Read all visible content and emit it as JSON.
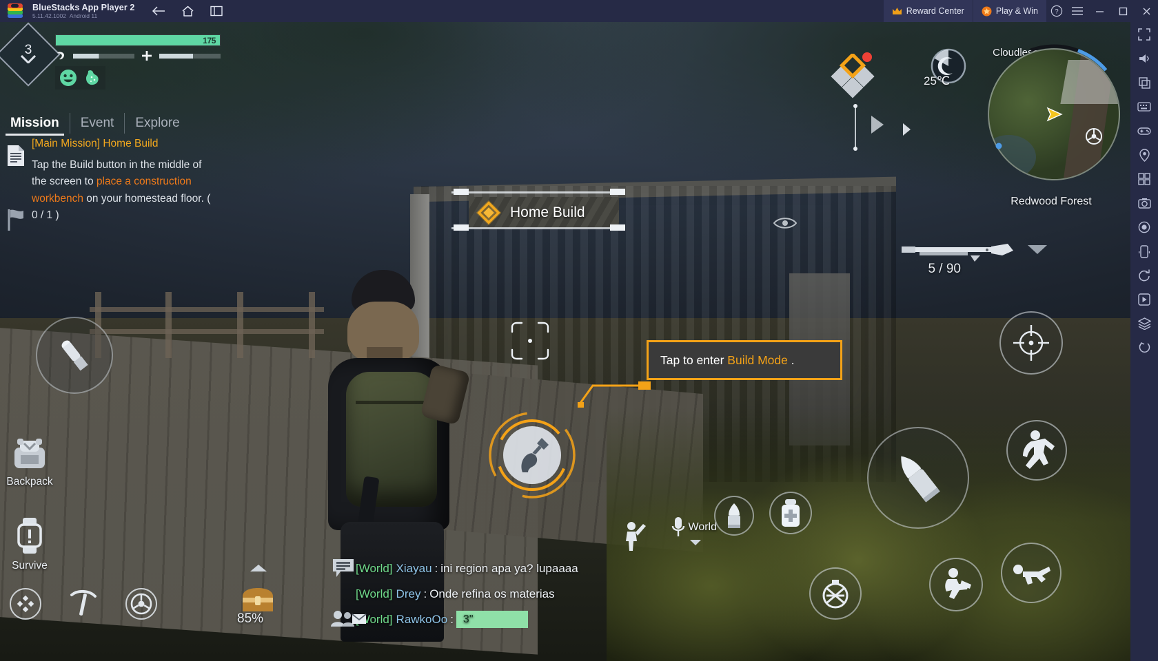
{
  "titlebar": {
    "app_name": "BlueStacks App Player 2",
    "version": "5.11.42.1002",
    "android": "Android 11",
    "nav": [
      {
        "name": "back-button",
        "label": "Back"
      },
      {
        "name": "home-button",
        "label": "Home"
      },
      {
        "name": "recents-button",
        "label": "Recents"
      }
    ],
    "reward_center": "Reward Center",
    "play_and_win": "Play & Win",
    "help": "?",
    "menu": "☰",
    "minimize": "—",
    "maximize": "□",
    "close": "✕"
  },
  "hud": {
    "level": "3",
    "health_text": "175",
    "health_pct": 100,
    "hunger_pct": 42,
    "thirst_pct": 55,
    "status_icons": [
      "mood-icon",
      "stomach-icon"
    ]
  },
  "mission": {
    "tabs": [
      {
        "label": "Mission",
        "active": true
      },
      {
        "label": "Event",
        "active": false
      },
      {
        "label": "Explore",
        "active": false
      }
    ],
    "title": "[Main Mission] Home Build",
    "desc_part1": "Tap the Build button in the middle of the screen to ",
    "desc_highlight": "place a construction workbench",
    "desc_part2": " on your homestead floor. ( 0 / 1 )"
  },
  "environment": {
    "weather": "Cloudless",
    "temperature": "25℃",
    "region": "Redwood Forest"
  },
  "weapon": {
    "ammo": "5 / 90",
    "name": "shotgun-icon"
  },
  "objective_banner": {
    "label": "Home Build",
    "icon": "quest-diamond-icon"
  },
  "tooltip": {
    "prefix": "Tap to enter ",
    "highlight": "Build Mode",
    "suffix": " ."
  },
  "left_controls": {
    "reload": "reload-icon",
    "backpack_label": "Backpack",
    "survive_label": "Survive"
  },
  "tray": {
    "items": [
      {
        "name": "dpad-icon",
        "label": ""
      },
      {
        "name": "pickaxe-icon",
        "label": ""
      },
      {
        "name": "steering-wheel-icon",
        "label": ""
      },
      {
        "name": "chest-icon",
        "label": ""
      }
    ],
    "durability": "85%"
  },
  "chat": {
    "messages": [
      {
        "channel": "[World]",
        "user": "Xiayau",
        "sep": ":",
        "text": "ini region apa ya? lupaaaa"
      },
      {
        "channel": "[World]",
        "user": "Drey",
        "sep": ":",
        "text": "Onde refina os materias"
      },
      {
        "channel": "[World]",
        "user": "RawkoOo",
        "sep": ":",
        "text": "",
        "input_value": "3\""
      }
    ],
    "input_placeholder": ""
  },
  "voice": {
    "label": "World",
    "icon": "microphone-icon"
  },
  "right_controls": [
    {
      "name": "aim-button",
      "icon": "crosshair-icon"
    },
    {
      "name": "fire-button",
      "icon": "bullet-icon"
    },
    {
      "name": "jump-button",
      "icon": "jump-icon"
    },
    {
      "name": "crouch-button",
      "icon": "crouch-icon"
    },
    {
      "name": "prone-button",
      "icon": "prone-icon"
    },
    {
      "name": "switch-weapon-button",
      "icon": "grenade-icon"
    },
    {
      "name": "medkit-button",
      "icon": "medkit-icon"
    },
    {
      "name": "ammo-button",
      "icon": "ammo-icon"
    }
  ],
  "rail_icons": [
    "fullscreen-icon",
    "volume-icon",
    "copy-icon",
    "keyboard-icon",
    "gamepad-icon",
    "location-icon",
    "multi-instance-icon",
    "screenshot-icon",
    "record-icon",
    "shake-icon",
    "rotate-icon",
    "macro-icon",
    "layers-icon",
    "more-icon"
  ],
  "colors": {
    "accent": "#f4a217",
    "quest_title": "#f2a81e",
    "quest_highlight": "#ef7a1a",
    "health": "#5fd7a4",
    "chat_channel": "#6fd98a",
    "chat_user": "#8fc4e8",
    "titlebar_bg": "#262a46",
    "pill_bg": "#313558"
  }
}
